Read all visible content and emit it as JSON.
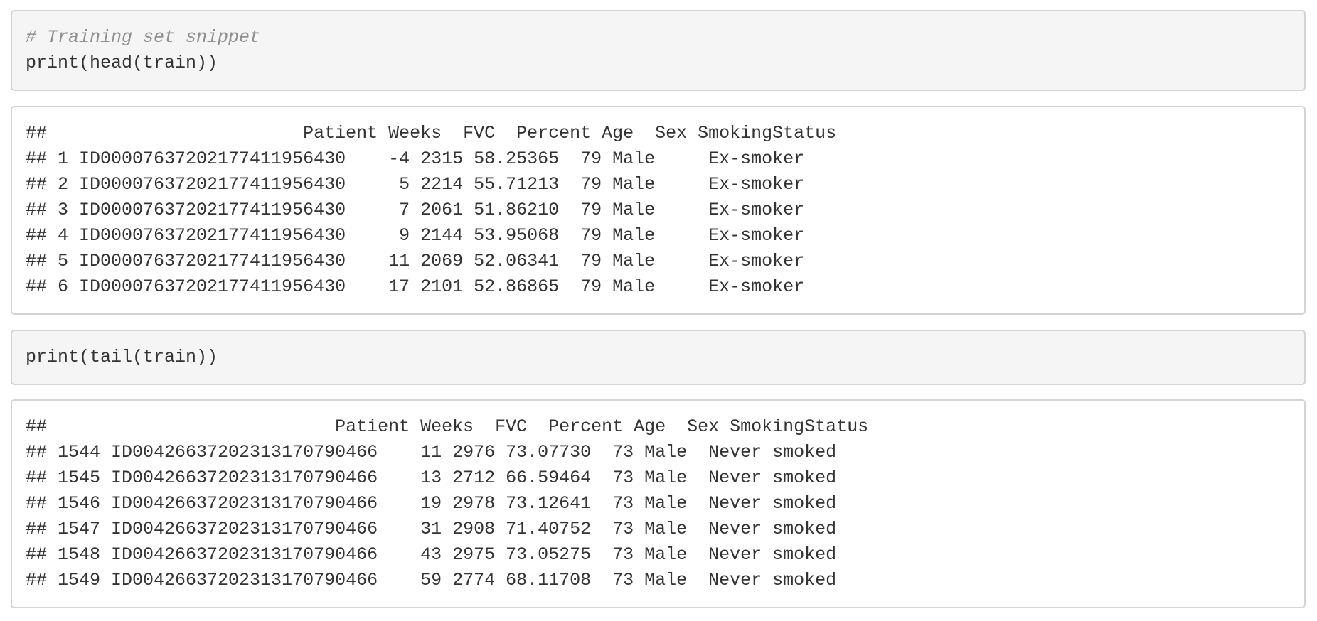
{
  "code_block_1": {
    "comment": "# Training set snippet",
    "code": "print(head(train))"
  },
  "output_1": {
    "lines": [
      "##                        Patient Weeks  FVC  Percent Age  Sex SmokingStatus",
      "## 1 ID00007637202177411956430    -4 2315 58.25365  79 Male     Ex-smoker",
      "## 2 ID00007637202177411956430     5 2214 55.71213  79 Male     Ex-smoker",
      "## 3 ID00007637202177411956430     7 2061 51.86210  79 Male     Ex-smoker",
      "## 4 ID00007637202177411956430     9 2144 53.95068  79 Male     Ex-smoker",
      "## 5 ID00007637202177411956430    11 2069 52.06341  79 Male     Ex-smoker",
      "## 6 ID00007637202177411956430    17 2101 52.86865  79 Male     Ex-smoker"
    ]
  },
  "code_block_2": {
    "code": "print(tail(train))"
  },
  "output_2": {
    "lines": [
      "##                           Patient Weeks  FVC  Percent Age  Sex SmokingStatus",
      "## 1544 ID00426637202313170790466    11 2976 73.07730  73 Male  Never smoked",
      "## 1545 ID00426637202313170790466    13 2712 66.59464  73 Male  Never smoked",
      "## 1546 ID00426637202313170790466    19 2978 73.12641  73 Male  Never smoked",
      "## 1547 ID00426637202313170790466    31 2908 71.40752  73 Male  Never smoked",
      "## 1548 ID00426637202313170790466    43 2975 73.05275  73 Male  Never smoked",
      "## 1549 ID00426637202313170790466    59 2774 68.11708  73 Male  Never smoked"
    ]
  }
}
